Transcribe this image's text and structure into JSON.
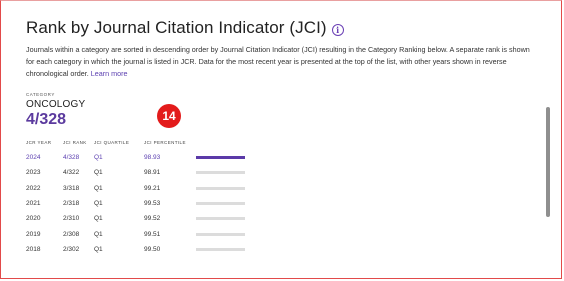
{
  "panel": {
    "title": "Rank by Journal Citation Indicator (JCI)",
    "info_icon": "info-icon",
    "description": "Journals within a category are sorted in descending order by Journal Citation Indicator (JCI) resulting in the Category Ranking below. A separate rank is shown for each category in which the journal is listed in JCR. Data for the most recent year is presented at the top of the list, with other years shown in reverse chronological order.",
    "learn_more": "Learn more"
  },
  "category": {
    "label": "CATEGORY",
    "name": "ONCOLOGY",
    "rank": "4/328"
  },
  "badge": "14",
  "table": {
    "headers": [
      "JCR YEAR",
      "JCI RANK",
      "JCI QUARTILE",
      "JCI PERCENTILE"
    ],
    "rows": [
      {
        "year": "2024",
        "rank": "4/328",
        "quartile": "Q1",
        "percentile": "98.93",
        "current": true
      },
      {
        "year": "2023",
        "rank": "4/322",
        "quartile": "Q1",
        "percentile": "98.91",
        "current": false
      },
      {
        "year": "2022",
        "rank": "3/318",
        "quartile": "Q1",
        "percentile": "99.21",
        "current": false
      },
      {
        "year": "2021",
        "rank": "2/318",
        "quartile": "Q1",
        "percentile": "99.53",
        "current": false
      },
      {
        "year": "2020",
        "rank": "2/310",
        "quartile": "Q1",
        "percentile": "99.52",
        "current": false
      },
      {
        "year": "2019",
        "rank": "2/308",
        "quartile": "Q1",
        "percentile": "99.51",
        "current": false
      },
      {
        "year": "2018",
        "rank": "2/302",
        "quartile": "Q1",
        "percentile": "99.50",
        "current": false
      }
    ]
  },
  "colors": {
    "accent": "#5b3aa8",
    "badge": "#e31b1b",
    "border": "#e24a4a",
    "bar_inactive": "#dcdcdc"
  }
}
